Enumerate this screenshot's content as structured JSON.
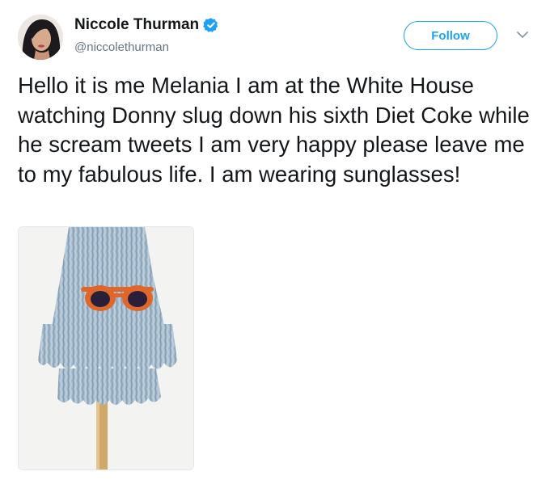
{
  "tweet": {
    "author_name": "Niccole Thurman",
    "author_handle": "@niccolethurman",
    "verified": true,
    "follow_label": "Follow",
    "text": "Hello it is me Melania I am at the White House watching Donny slug down his sixth Diet Coke while he scream tweets I am very happy please leave me to my fabulous life. I am wearing sunglasses!"
  },
  "icons": {
    "verified": "verified-badge-icon",
    "caret": "chevron-down-icon"
  },
  "colors": {
    "accent": "#1da1f2",
    "text": "#14171a",
    "secondary_text": "#657786"
  }
}
